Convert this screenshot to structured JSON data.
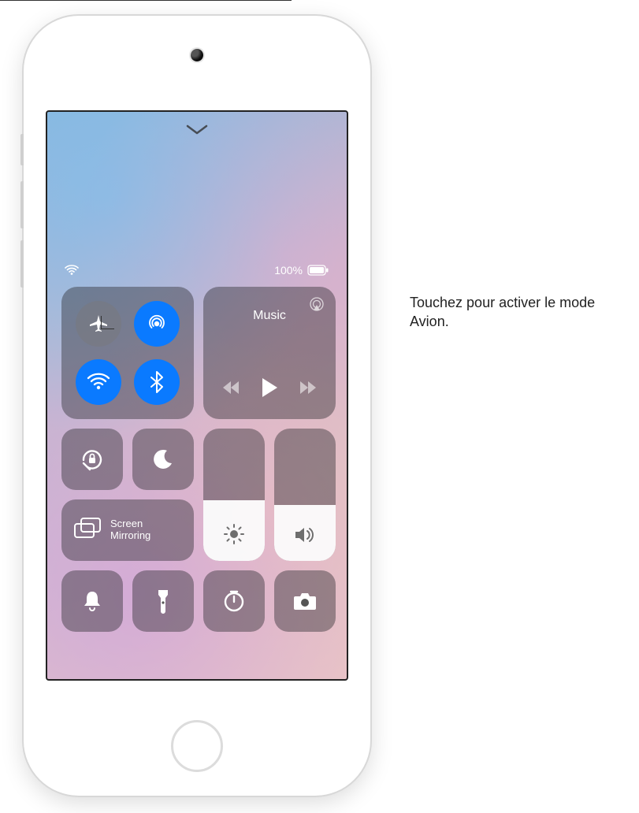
{
  "status": {
    "battery_pct": "100%"
  },
  "connectivity": {
    "airplane_on": false,
    "airdrop_on": true,
    "wifi_on": true,
    "bluetooth_on": true
  },
  "music": {
    "title": "Music"
  },
  "screen_mirroring": {
    "label_line1": "Screen",
    "label_line2": "Mirroring"
  },
  "sliders": {
    "brightness_pct": 46,
    "volume_pct": 42
  },
  "shortcuts": {
    "orientation_lock": "orientation-lock",
    "dnd": "do-not-disturb",
    "bell": "sound",
    "flashlight": "flashlight",
    "timer": "timer",
    "camera": "camera"
  },
  "callout": {
    "text": "Touchez pour activer le mode Avion."
  }
}
